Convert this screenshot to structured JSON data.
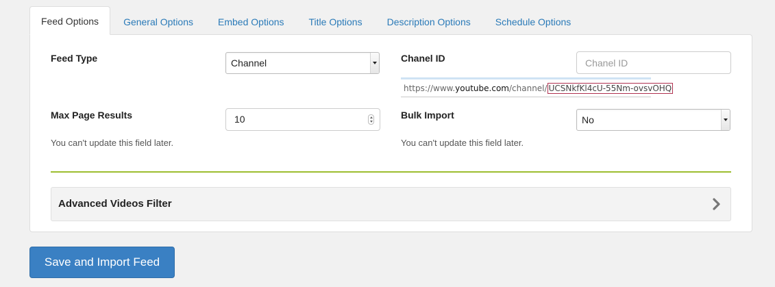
{
  "tabs": [
    {
      "label": "Feed Options",
      "active": true
    },
    {
      "label": "General Options"
    },
    {
      "label": "Embed Options"
    },
    {
      "label": "Title Options"
    },
    {
      "label": "Description Options"
    },
    {
      "label": "Schedule Options"
    }
  ],
  "form": {
    "feed_type": {
      "label": "Feed Type",
      "value": "Channel"
    },
    "channel_id": {
      "label": "Chanel ID",
      "placeholder": "Chanel ID",
      "hint_prefix": "https://www.",
      "hint_domain": "youtube.com",
      "hint_path": "/channel/",
      "hint_example_id": "UCSNkfKl4cU-55Nm-ovsvOHQ"
    },
    "max_page_results": {
      "label": "Max Page Results",
      "value": "10",
      "help": "You can't update this field later."
    },
    "bulk_import": {
      "label": "Bulk Import",
      "value": "No",
      "help": "You can't update this field later."
    }
  },
  "accordion": {
    "title": "Advanced Videos Filter",
    "icon": "chevron-right-icon"
  },
  "actions": {
    "save_label": "Save and Import Feed"
  },
  "colors": {
    "accent": "#3a80c3",
    "divider": "#9cbd2e",
    "link": "#2a7ab8"
  }
}
